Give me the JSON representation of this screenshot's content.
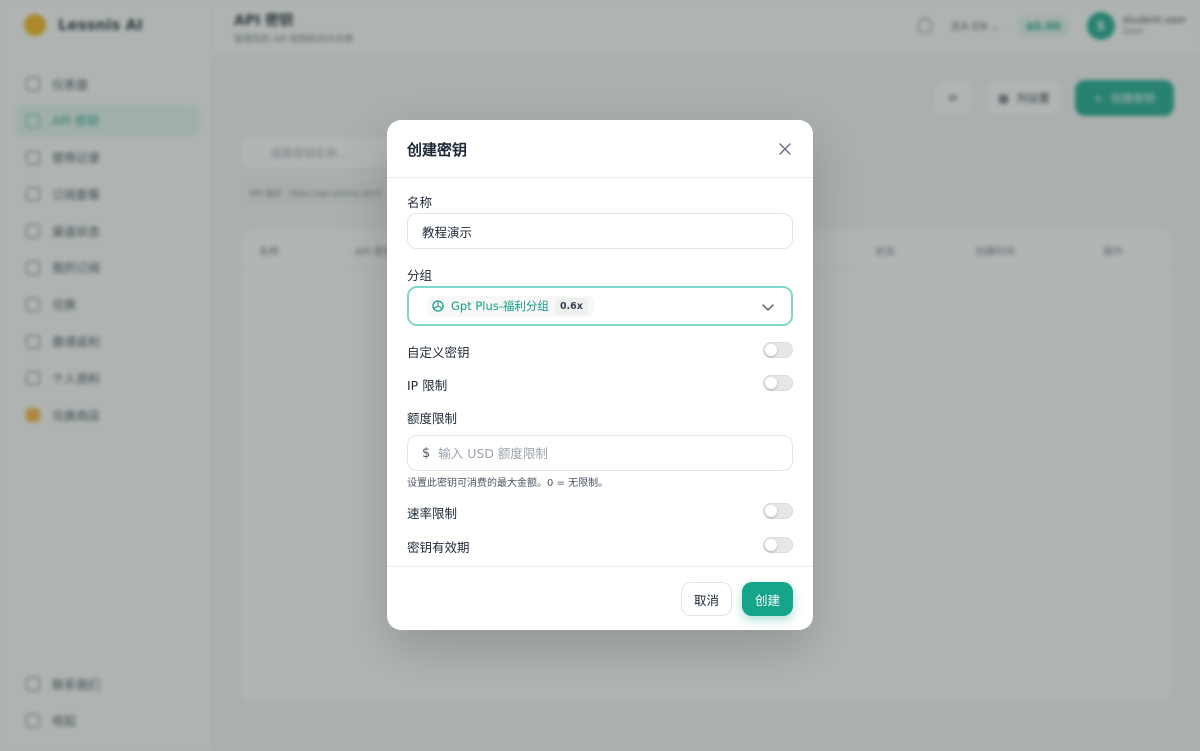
{
  "sidebar": {
    "brand": "Lessnis AI",
    "items": [
      {
        "label": "仪表盘",
        "icon": "dashboard-icon"
      },
      {
        "label": "API 密钥",
        "icon": "key-icon",
        "active": true
      },
      {
        "label": "使用记录",
        "icon": "chart-icon"
      },
      {
        "label": "订阅套餐",
        "icon": "subscription-icon"
      },
      {
        "label": "渠道状态",
        "icon": "status-icon"
      },
      {
        "label": "我的订阅",
        "icon": "calendar-icon"
      },
      {
        "label": "兑换",
        "icon": "gift-icon"
      },
      {
        "label": "邀请返利",
        "icon": "invite-icon"
      },
      {
        "label": "个人资料",
        "icon": "user-icon"
      },
      {
        "label": "兑换商店",
        "icon": "ticket-icon"
      }
    ],
    "bottom": [
      {
        "label": "联系我们",
        "icon": "phone-icon"
      },
      {
        "label": "收起",
        "icon": "collapse-icon"
      }
    ]
  },
  "header": {
    "title": "API 密钥",
    "subtitle": "管理您的 API 密钥和访问令牌",
    "lang": "EN",
    "balance": "$0.00",
    "user_initial": "S",
    "user_name": "student.user",
    "user_role": "User"
  },
  "toolbar": {
    "refresh_label": "",
    "columns_label": "列设置",
    "create_label": "创建密钥"
  },
  "main": {
    "search_placeholder": "搜索密钥名称…",
    "endpoint": "API 端点：https://api.lessnis.ai/v1",
    "columns": [
      "名称",
      "API 密钥",
      "状态",
      "创建时间",
      "操作"
    ]
  },
  "modal": {
    "title": "创建密钥",
    "name_label": "名称",
    "name_value": "教程演示",
    "group_label": "分组",
    "group_value": "Gpt Plus-福利分组",
    "group_multiplier": "0.6x",
    "custom_key_label": "自定义密钥",
    "custom_key_enabled": false,
    "ip_limit_label": "IP 限制",
    "ip_limit_enabled": false,
    "quota_label": "额度限制",
    "quota_currency": "$",
    "quota_placeholder": "输入 USD 额度限制",
    "quota_hint": "设置此密钥可消费的最大金额。0 = 无限制。",
    "rate_limit_label": "速率限制",
    "rate_limit_enabled": false,
    "expiry_label": "密钥有效期",
    "expiry_enabled": false,
    "cancel_label": "取消",
    "create_label": "创建"
  },
  "colors": {
    "accent": "#14a58b",
    "focus_border": "#7fd8c8",
    "overlay": "rgba(70,80,76,0.42)"
  }
}
